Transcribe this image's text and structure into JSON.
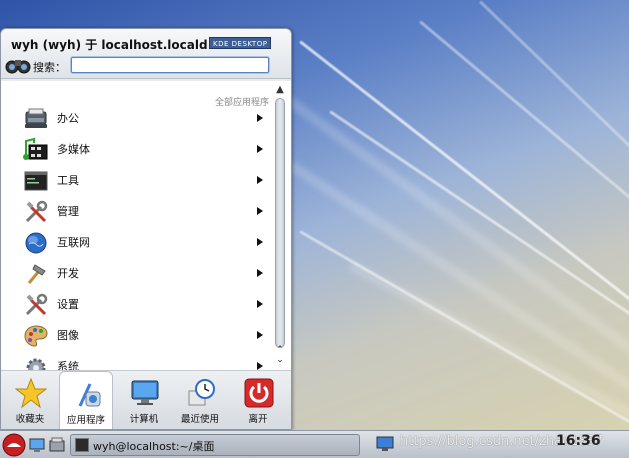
{
  "menu": {
    "user_line": "wyh (wyh) 于 localhost.localdomain",
    "badge": "KDE DESKTOP",
    "search_label": "搜索：",
    "search_value": "",
    "breadcrumb": "全部应用程序",
    "items": [
      {
        "label": "办公",
        "icon": "office-typewriter-icon"
      },
      {
        "label": "多媒体",
        "icon": "multimedia-icon"
      },
      {
        "label": "工具",
        "icon": "utilities-terminal-icon"
      },
      {
        "label": "管理",
        "icon": "system-tools-icon"
      },
      {
        "label": "互联网",
        "icon": "internet-globe-icon"
      },
      {
        "label": "开发",
        "icon": "development-hammer-icon"
      },
      {
        "label": "设置",
        "icon": "settings-tools-icon"
      },
      {
        "label": "图像",
        "icon": "graphics-palette-icon"
      },
      {
        "label": "系统",
        "icon": "system-gear-icon"
      }
    ],
    "tabs": [
      {
        "label": "收藏夹",
        "icon": "favorites-star-icon"
      },
      {
        "label": "应用程序",
        "icon": "applications-icon"
      },
      {
        "label": "计算机",
        "icon": "computer-monitor-icon"
      },
      {
        "label": "最近使用",
        "icon": "recent-clock-icon"
      },
      {
        "label": "离开",
        "icon": "leave-power-icon"
      }
    ]
  },
  "taskbar": {
    "task_label": "wyh@localhost:~/桌面",
    "watermark": "https://blog.csdn.net/zhao1837",
    "clock": "16:36"
  },
  "colors": {
    "accent": "#3e5f96",
    "leave": "#d42a2a"
  }
}
